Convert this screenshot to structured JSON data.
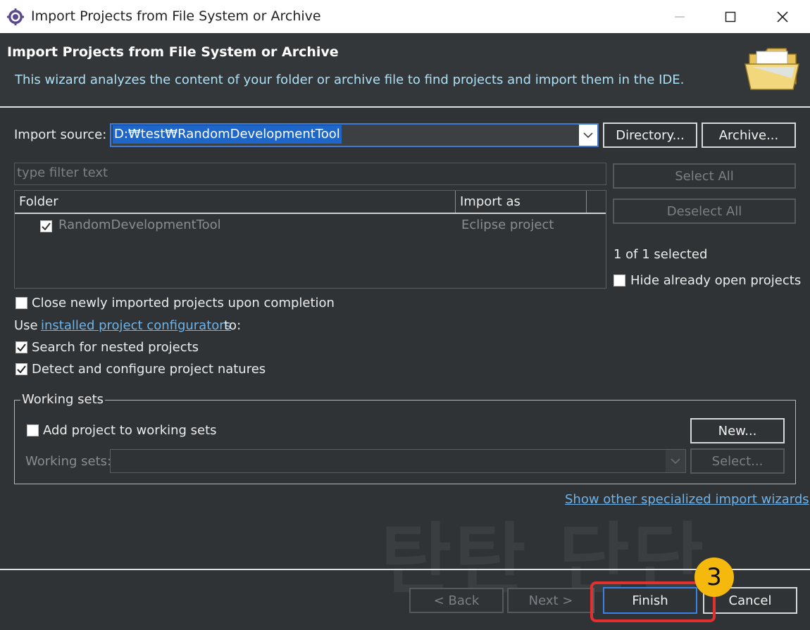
{
  "window": {
    "title": "Import Projects from File System or Archive",
    "icon": "eclipse-gear-icon"
  },
  "banner": {
    "title": "Import Projects from File System or Archive",
    "description": "This wizard analyzes the content of your folder or archive file to find projects and import them in the IDE.",
    "icon": "folder-open-icon"
  },
  "import_source": {
    "label": "Import source:",
    "value": "D:₩test₩RandomDevelopmentTool",
    "directory_button": "Directory...",
    "archive_button": "Archive..."
  },
  "filter": {
    "placeholder": "type filter text"
  },
  "table": {
    "columns": [
      "Folder",
      "Import as"
    ],
    "rows": [
      {
        "folder": "RandomDevelopmentTool",
        "import_as": "Eclipse project",
        "checked": true
      }
    ]
  },
  "side": {
    "select_all": "Select All",
    "deselect_all": "Deselect All",
    "selected_count": "1 of 1 selected",
    "hide_open_label": "Hide already open projects",
    "hide_open_checked": false
  },
  "options": {
    "close_label": "Close newly imported projects upon completion",
    "close_checked": false,
    "use_prefix": "Use",
    "configurators_link": "installed project configurators",
    "use_suffix": "to:",
    "nested_label": "Search for nested projects",
    "nested_checked": true,
    "detect_label": "Detect and configure project natures",
    "detect_checked": true
  },
  "working_sets": {
    "title": "Working sets",
    "add_label": "Add project to working sets",
    "add_checked": false,
    "new_button": "New...",
    "sets_label": "Working sets:",
    "select_button": "Select..."
  },
  "other_wizards_link": "Show other specialized import wizards",
  "watermark": "탄탄 단단",
  "footer": {
    "back": "< Back",
    "next": "Next >",
    "finish": "Finish",
    "cancel": "Cancel"
  },
  "annotation": {
    "step_number": "3",
    "highlight_color": "#e52e2e",
    "badge_color": "#f5b90d"
  }
}
